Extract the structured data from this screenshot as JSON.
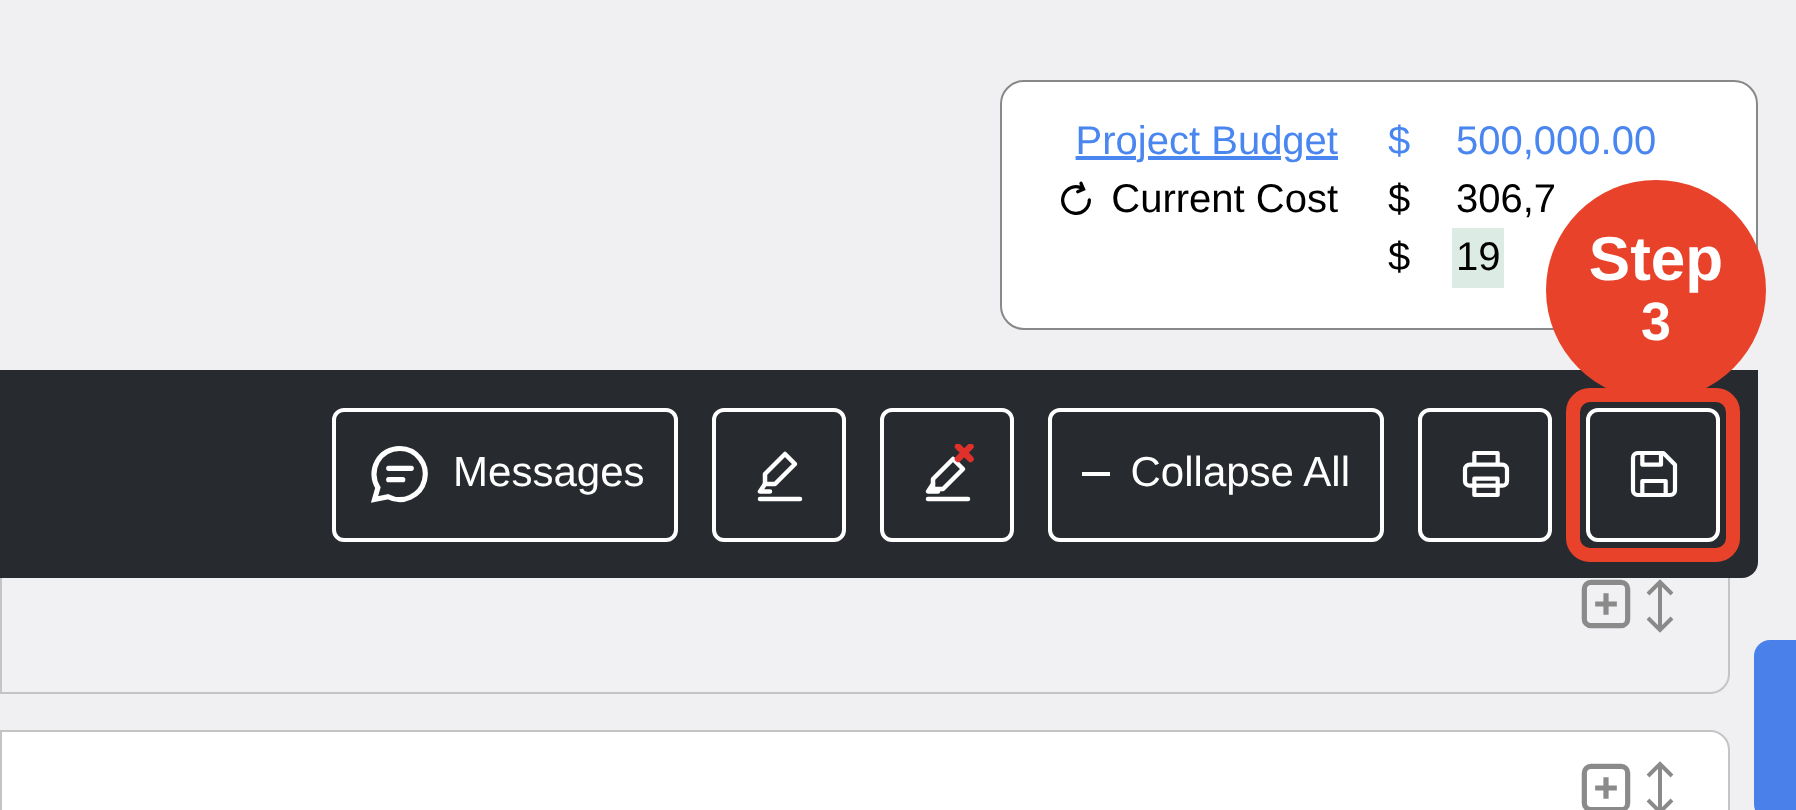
{
  "budget": {
    "rows": [
      {
        "kind": "link",
        "label": "Project Budget",
        "currency": "$",
        "amount": "500,000.00"
      },
      {
        "kind": "refresh",
        "label": "Current Cost",
        "currency": "$",
        "amount": "306,7"
      },
      {
        "kind": "highlight",
        "currency": "$",
        "amount": "19"
      }
    ]
  },
  "step_badge": {
    "word": "Step",
    "number": "3"
  },
  "toolbar": {
    "buttons": [
      {
        "kind": "messages",
        "label": "Messages",
        "highlighted": false
      },
      {
        "kind": "highlight",
        "highlighted": false
      },
      {
        "kind": "clear-highlight",
        "highlighted": false
      },
      {
        "kind": "collapse",
        "label": "Collapse All",
        "highlighted": false
      },
      {
        "kind": "print",
        "highlighted": false
      },
      {
        "kind": "save",
        "highlighted": true
      }
    ]
  },
  "sections": [
    {
      "expanded": false
    },
    {
      "expanded": false
    }
  ]
}
